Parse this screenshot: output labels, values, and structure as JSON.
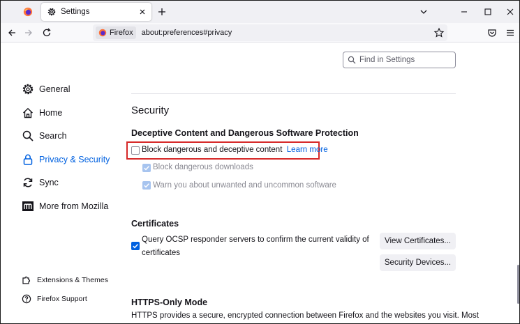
{
  "browser": {
    "tab_title": "Settings",
    "identity_label": "Firefox",
    "url": "about:preferences#privacy"
  },
  "search": {
    "placeholder": "Find in Settings"
  },
  "sidebar": {
    "categories": [
      {
        "label": "General",
        "icon": "gear-icon"
      },
      {
        "label": "Home",
        "icon": "home-icon"
      },
      {
        "label": "Search",
        "icon": "search-icon"
      },
      {
        "label": "Privacy & Security",
        "icon": "lock-icon",
        "selected": true
      },
      {
        "label": "Sync",
        "icon": "sync-icon"
      },
      {
        "label": "More from Mozilla",
        "icon": "mozilla-icon"
      }
    ],
    "footer": [
      {
        "label": "Extensions & Themes",
        "icon": "puzzle-icon"
      },
      {
        "label": "Firefox Support",
        "icon": "help-icon"
      }
    ]
  },
  "security": {
    "heading": "Security",
    "deceptive": {
      "heading": "Deceptive Content and Dangerous Software Protection",
      "block_label": "Block dangerous and deceptive content",
      "block_checked": false,
      "learn_more": "Learn more",
      "downloads_label": "Block dangerous downloads",
      "downloads_checked": true,
      "unwanted_label": "Warn you about unwanted and uncommon software",
      "unwanted_checked": true
    },
    "certificates": {
      "heading": "Certificates",
      "ocsp_label_line1": "Query OCSP responder servers to confirm the current validity of",
      "ocsp_label_line2": "certificates",
      "ocsp_checked": true,
      "view_button": "View Certificates...",
      "devices_button": "Security Devices..."
    },
    "https": {
      "heading": "HTTPS-Only Mode",
      "description": "HTTPS provides a secure, encrypted connection between Firefox and the websites you visit. Most"
    }
  },
  "colors": {
    "accent": "#0061e0",
    "highlight_border": "#d62828"
  }
}
